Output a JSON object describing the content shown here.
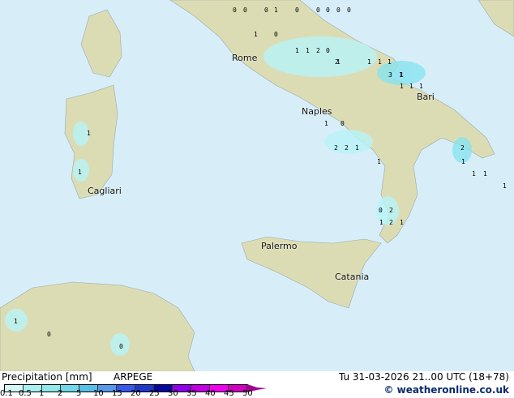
{
  "map": {
    "cities": [
      {
        "name": "Rome"
      },
      {
        "name": "Naples"
      },
      {
        "name": "Bari"
      },
      {
        "name": "Cagliari"
      },
      {
        "name": "Palermo"
      },
      {
        "name": "Catania"
      }
    ],
    "values": [
      "0",
      "0",
      "0",
      "1",
      "0",
      "0",
      "0",
      "0",
      "0",
      "1",
      "0",
      "1",
      "1",
      "2",
      "0",
      "1",
      "2",
      "1",
      "1",
      "1",
      "1",
      "3",
      "1",
      "1",
      "1",
      "1",
      "1",
      "1",
      "1",
      "2",
      "2",
      "1",
      "1",
      "2",
      "0",
      "2",
      "1",
      "1",
      "2",
      "1",
      "1",
      "1",
      "1",
      "1",
      "0",
      "0",
      "0"
    ],
    "colors": {
      "sea": "#d7eef8",
      "land": "#dcdcb4",
      "precip_light": "#b8f4f8",
      "precip_mid": "#88e4f0",
      "precip_high": "#58c0e8"
    }
  },
  "legend": {
    "title": "Precipitation [mm]",
    "model": "ARPEGE",
    "datetime": "Tu 31-03-2026 21..00 UTC (18+78)",
    "copyright": "© weatheronline.co.uk",
    "ticks": [
      "0.1",
      "0.5",
      "1",
      "2",
      "5",
      "10",
      "15",
      "20",
      "25",
      "30",
      "35",
      "40",
      "45",
      "50"
    ],
    "colors": [
      "#d4f8f8",
      "#a8f0f0",
      "#90e8e8",
      "#70d8e8",
      "#58c0e8",
      "#5898e8",
      "#3858e8",
      "#2038c8",
      "#0808a0",
      "#9000e8",
      "#c000e0",
      "#f000f0",
      "#d000c0"
    ],
    "arrow_color": "#a00090"
  }
}
